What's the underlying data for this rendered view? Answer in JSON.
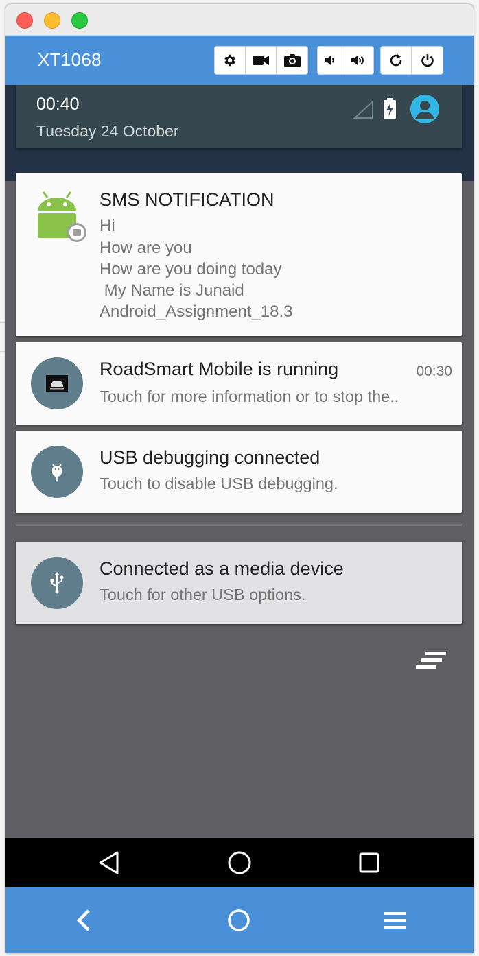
{
  "window": {
    "device_name": "XT1068",
    "toolbar_icons": [
      "gear-icon",
      "video-camera-icon",
      "camera-icon",
      "volume-down-icon",
      "volume-up-icon",
      "rotate-icon",
      "power-icon"
    ],
    "accent_color": "#4a90d9"
  },
  "status": {
    "time": "00:40",
    "date": "Tuesday 24 October"
  },
  "notifications": {
    "sms": {
      "title": "SMS NOTIFICATION",
      "lines": [
        "Hi",
        "How are you",
        "How are you doing today",
        " My Name is Junaid",
        "Android_Assignment_18.3"
      ]
    },
    "roadsmart": {
      "title": "RoadSmart Mobile is running",
      "subtitle": "Touch for more information or to stop the..",
      "time": "00:30"
    },
    "usb_debug": {
      "title": "USB debugging connected",
      "subtitle": "Touch to disable USB debugging."
    },
    "media": {
      "title": "Connected as a media device",
      "subtitle": "Touch for other USB options."
    }
  },
  "android_nav": [
    "back-triangle-icon",
    "home-circle-icon",
    "recents-square-icon"
  ],
  "bottom_nav": [
    "back-chevron-icon",
    "home-icon",
    "menu-icon"
  ]
}
